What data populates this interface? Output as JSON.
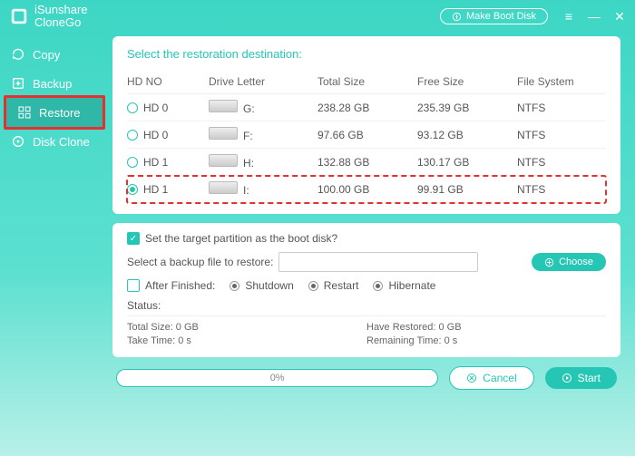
{
  "app": {
    "name1": "iSunshare",
    "name2": "CloneGo",
    "boot_btn": "Make Boot Disk"
  },
  "sidebar": {
    "items": [
      {
        "label": "Copy"
      },
      {
        "label": "Backup"
      },
      {
        "label": "Restore"
      },
      {
        "label": "Disk Clone"
      }
    ]
  },
  "restore": {
    "title": "Select the restoration destination:",
    "headers": {
      "hdno": "HD NO",
      "letter": "Drive Letter",
      "total": "Total Size",
      "free": "Free Size",
      "fs": "File System"
    },
    "rows": [
      {
        "hd": "HD 0",
        "letter": "G:",
        "total": "238.28 GB",
        "free": "235.39 GB",
        "fs": "NTFS",
        "selected": false
      },
      {
        "hd": "HD 0",
        "letter": "F:",
        "total": "97.66 GB",
        "free": "93.12 GB",
        "fs": "NTFS",
        "selected": false
      },
      {
        "hd": "HD 1",
        "letter": "H:",
        "total": "132.88 GB",
        "free": "130.17 GB",
        "fs": "NTFS",
        "selected": false
      },
      {
        "hd": "HD 1",
        "letter": "I:",
        "total": "100.00 GB",
        "free": "99.91 GB",
        "fs": "NTFS",
        "selected": true
      }
    ]
  },
  "options": {
    "target_boot_label": "Set the target partition as the boot disk?",
    "target_boot_checked": true,
    "backup_label": "Select a backup file to restore:",
    "backup_value": "",
    "choose_label": "Choose",
    "after_label": "After Finished:",
    "after_checked": false,
    "after_opts": {
      "shutdown": "Shutdown",
      "restart": "Restart",
      "hibernate": "Hibernate"
    }
  },
  "status": {
    "label": "Status:",
    "total": "Total Size: 0 GB",
    "restored": "Have Restored: 0 GB",
    "take": "Take Time: 0 s",
    "remain": "Remaining Time: 0 s"
  },
  "footer": {
    "progress": "0%",
    "cancel": "Cancel",
    "start": "Start"
  }
}
